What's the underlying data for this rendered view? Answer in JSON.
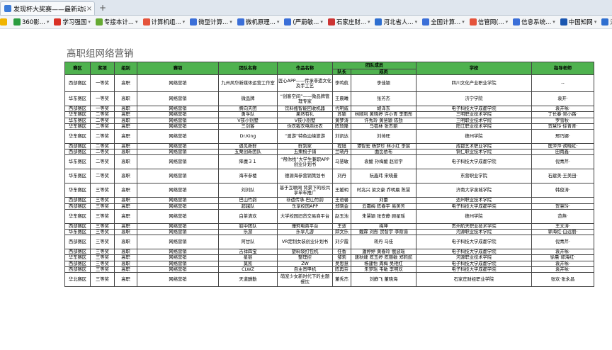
{
  "browser": {
    "tab_title": "发现杯大奖赛——最新动态",
    "tab_close": "×",
    "new_tab": "+",
    "bookmarks": [
      {
        "icon": "star-icon",
        "label": "",
        "color": "#f0b400"
      },
      {
        "icon": "browser-360-icon",
        "label": "360影...",
        "color": "#2a9d3f"
      },
      {
        "icon": "xuexi-icon",
        "label": "学习强国",
        "color": "#d93025"
      },
      {
        "icon": "cross-icon",
        "label": "专接本计...",
        "color": "#6a3"
      },
      {
        "icon": "s-icon",
        "label": "计算机组...",
        "color": "#e5533b"
      },
      {
        "icon": "circle-icon",
        "label": "微型计算...",
        "color": "#3b6fd8"
      },
      {
        "icon": "square-icon",
        "label": "微机原理...",
        "color": "#3b6fd8"
      },
      {
        "icon": "circle-icon",
        "label": "(严蔚敏...",
        "color": "#3b6fd8"
      },
      {
        "icon": "house-icon",
        "label": "石家庄财...",
        "color": "#c33"
      },
      {
        "icon": "paw-icon",
        "label": "河北省人...",
        "color": "#2f6fd0"
      },
      {
        "icon": "globe-icon",
        "label": "全国计算...",
        "color": "#3b6fd8"
      },
      {
        "icon": "circle-icon",
        "label": "信管网(...",
        "color": "#e5533b"
      },
      {
        "icon": "circle-icon",
        "label": "信息系统...",
        "color": "#3b6fd8"
      },
      {
        "icon": "cnki-icon",
        "label": "中国知网",
        "color": "#1a56b0"
      },
      {
        "icon": "paw-icon",
        "label": "河北省人...",
        "color": "#2f6fd0"
      }
    ]
  },
  "page": {
    "heading": "高职组网络营销",
    "columns": [
      "赛区",
      "奖项",
      "组别",
      "赛项",
      "团队名称",
      "作品名称",
      "团队成员",
      "学校",
      "指导老师"
    ],
    "member_subcols": [
      "队长",
      "成员"
    ],
    "rows": [
      [
        "西部赛区",
        "一等奖",
        "高职",
        "网络营销",
        "九州风华新媒体运营工作室",
        "匠心APP——传承非遗文化及手工艺",
        "李鸣航",
        "李佳颖",
        "四川文化产业职业学院",
        "--"
      ],
      [
        "华东赛区",
        "一等奖",
        "高职",
        "网络营销",
        "微品牌",
        "“创客空间”——微品牌管理专家",
        "王晨曦",
        "张芳杰",
        "济宁学院",
        "袁开·"
      ],
      [
        "西部赛区",
        "一等奖",
        "高职",
        "网络营销",
        "腾向天团",
        "饮料瓶智能回收机器",
        "代明威",
        "胡泽东",
        "电子科技大学成都学院",
        "袁卉咏·"
      ],
      [
        "华东赛区",
        "二等奖",
        "高职",
        "网络营销",
        "勇孚队",
        "果然有礼",
        "苏颖",
        "林顺利 黄晓婷 许小青 李雨彤",
        "三明职业技术学院",
        "丁长春·吴小路·"
      ],
      [
        "华东赛区",
        "二等奖",
        "高职",
        "网络营销",
        "V孩小别墅",
        "V孩小别墅",
        "黄梦涛",
        "许秀玲 黄慧颖 陈劲",
        "三明职业技术学院",
        "罗雪秋·"
      ],
      [
        "华东赛区",
        "二等奖",
        "高职",
        "网络营销",
        "三剑客",
        "你衣我衣电商扶农",
        "陈琦隆",
        "马蓓林 张杰丽",
        "阳江职业技术学院",
        "贺慧玲·徐青青·"
      ],
      [
        "华东赛区",
        "二等奖",
        "高职",
        "网络营销",
        "Dr.King",
        "“渡游”特色边境旅游",
        "刘凯达",
        "刘帅旺",
        "德州学院",
        "邢巧娜·"
      ],
      [
        "西部赛区",
        "二等奖",
        "高职",
        "网络营销",
        "遇见新鲜",
        "鲜到家",
        "程旭",
        "谭智宏 杨梦珍 林小红 李宸",
        "成都艺术职业学院",
        "医萍萍·胡晓虹·"
      ],
      [
        "西部赛区",
        "二等奖",
        "高职",
        "网络营销",
        "五栗创新团队",
        "五栗梳子铺",
        "兰晓丹",
        "曲比依布",
        "铜仁职业技术学院",
        "田雨鑫·"
      ],
      [
        "华东赛区",
        "二等奖",
        "高职",
        "网络营销",
        "降魔３１",
        "“帮你找”大学生兼职APP创业计划书",
        "马慧敏",
        "袁媛 孙梅媛 赵欣宇",
        "电子科技大学成都学院",
        "倪青芹·"
      ],
      [
        "华东赛区",
        "二等奖",
        "高职",
        "网络营销",
        "海市参楼",
        "德源海参营销策划书",
        "刘丹",
        "阮鑫玮 宋晓曼",
        "东营职业学院",
        "石建美·王美田·"
      ],
      [
        "华东赛区",
        "三等奖",
        "高职",
        "网络营销",
        "刘刘队",
        "基于互联网 背景下的校共享单车推广",
        "王媛玥",
        "时兆兴 梁文豪 乔明晨 陈慧",
        "济南大学泉城学院",
        "韩俊涛·"
      ],
      [
        "西部赛区",
        "三等奖",
        "高职",
        "网络营销",
        "巴山竹韵",
        "非遗传承-巴山竹韵",
        "王语馨",
        "刘蕾",
        "达州职业技术学院",
        ""
      ],
      [
        "西部赛区",
        "三等奖",
        "高职",
        "网络营销",
        "超越队",
        "乐享校园APP",
        "郑晓金",
        "云霜梅 陈春宇 易美芳",
        "电子科技大学成都学院",
        "贺慧玲·"
      ],
      [
        "华东赛区",
        "三等奖",
        "高职",
        "网络营销",
        "白茶清欢",
        "大学校园旧货交易商平台",
        "赵玉池",
        "朱慧颖 张安静 顾星瑶",
        "德州学院",
        "范燕·"
      ],
      [
        "西部赛区",
        "三等奖",
        "高职",
        "网络营销",
        "貂中团队",
        "珊珂电商平台",
        "王波",
        "梅坤",
        "贵州航天职业技术学院",
        "王文涛·"
      ],
      [
        "华东赛区",
        "三等奖",
        "高职",
        "网络营销",
        "乐游",
        "乐享几游",
        "邱文乐",
        "戴霖 刘彤 贺智宇 李斯渝",
        "河源职业技术学院",
        "郭海红·白远丽·"
      ],
      [
        "西部赛区",
        "三等奖",
        "高职",
        "网络营销",
        "阿甘队",
        "VR定制女装创业计划书",
        "刘夕霞",
        "蒋丹 马佳",
        "电子科技大学成都学院",
        "倪青芹·"
      ],
      [
        "西部赛区",
        "三等奖",
        "高职",
        "网络营销",
        "吉祥四宝",
        "塑料袋打包机",
        "任香",
        "潘婷婷 黄春玲 俄波瑶",
        "电子科技大学成都学院",
        "袁卉咏·"
      ],
      [
        "华东赛区",
        "三等奖",
        "高职",
        "网络营销",
        "星链",
        "整理控",
        "邹莉",
        "唐秋婕 陈玉婷 陈丽敏 郑莉航",
        "河源职业技术学院",
        "徐晨·郭海红·"
      ],
      [
        "西部赛区",
        "三等奖",
        "高职",
        "网络营销",
        "莫凯",
        "ZW",
        "吴思慧",
        "杨建怡 周梅 吴艳红",
        "电子科技大学成都学院",
        "袁卉咏·"
      ],
      [
        "西部赛区",
        "三等奖",
        "高职",
        "网络营销",
        "CLWZ",
        "自主贵甲机",
        "陈再芬",
        "朱梦瑶 韦敏 李明欢",
        "电子科技大学成都学院",
        "袁卉咏·"
      ],
      [
        "华北赛区",
        "三等奖",
        "高职",
        "网络营销",
        "天道酬勤",
        "萌宠少女新时代下的主题餐饮",
        "董秀杰",
        "刘静飞 董晓海",
        "石家庄财经职业学院",
        "张欢·张永昌"
      ]
    ],
    "row_heights": [],
    "colors": {
      "header_bg": "#4fb24f",
      "border": "#444444",
      "heading": "#5a5a5a"
    }
  }
}
